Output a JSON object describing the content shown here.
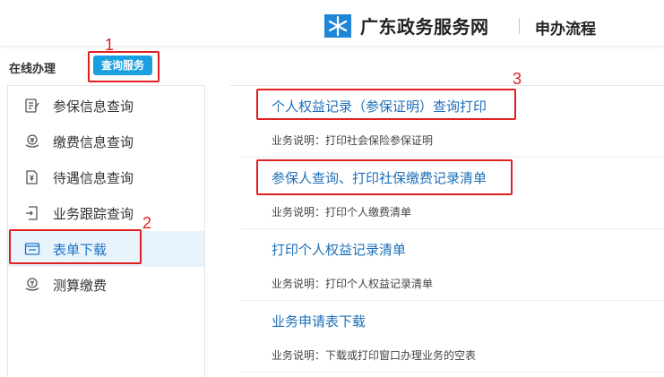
{
  "header": {
    "brand": "广东政务服务网",
    "section": "申办流程"
  },
  "subbar": {
    "label": "在线办理",
    "query_button": "查询服务"
  },
  "annotations": [
    "1",
    "2",
    "3"
  ],
  "sidebar": {
    "items": [
      {
        "label": "参保信息查询",
        "icon": "edit-document-icon"
      },
      {
        "label": "缴费信息查询",
        "icon": "payment-icon"
      },
      {
        "label": "待遇信息查询",
        "icon": "document-money-icon"
      },
      {
        "label": "业务跟踪查询",
        "icon": "document-track-icon"
      },
      {
        "label": "表单下载",
        "icon": "form-icon"
      },
      {
        "label": "测算缴费",
        "icon": "calculate-icon"
      }
    ],
    "active_index": 4
  },
  "main": {
    "entries": [
      {
        "title": "个人权益记录（参保证明）查询打印",
        "desc": "业务说明：打印社会保险参保证明"
      },
      {
        "title": "参保人查询、打印社保缴费记录清单",
        "desc": "业务说明：打印个人缴费清单"
      },
      {
        "title": "打印个人权益记录清单",
        "desc": "业务说明：打印个人权益记录清单"
      },
      {
        "title": "业务申请表下载",
        "desc": "业务说明：下载或打印窗口办理业务的空表"
      }
    ]
  },
  "colors": {
    "accent": "#1aa0e0",
    "link": "#1e6fb8",
    "annotation": "#e0201f",
    "active_bg": "#e9f3fc"
  }
}
